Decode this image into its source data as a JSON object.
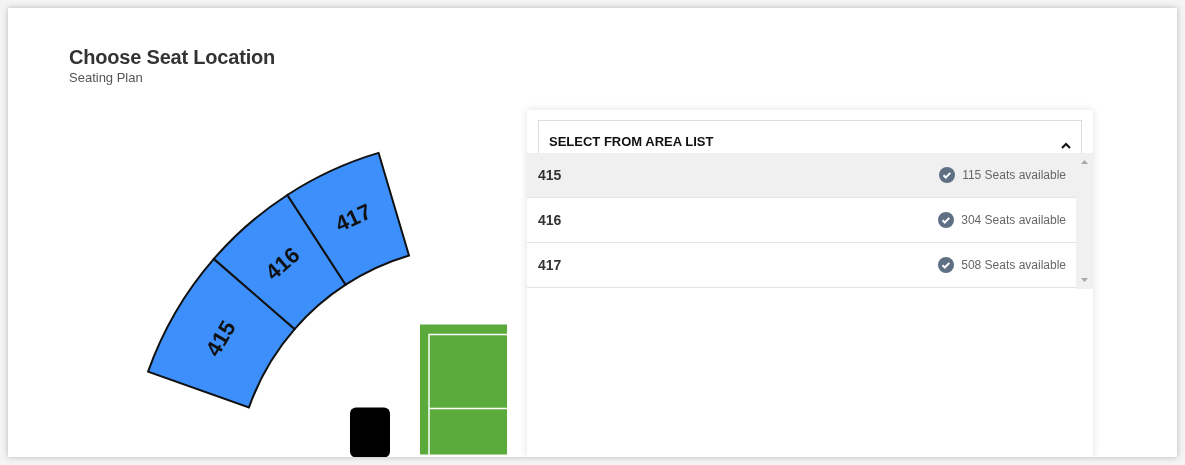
{
  "title": "Choose Seat Location",
  "subtitle": "Seating Plan",
  "seat_map": {
    "sections": [
      {
        "label": "415"
      },
      {
        "label": "416"
      },
      {
        "label": "417"
      }
    ]
  },
  "area_list": {
    "header": "SELECT FROM AREA LIST",
    "expanded": true,
    "items": [
      {
        "label": "415",
        "seats": "115 Seats available",
        "selected": true
      },
      {
        "label": "416",
        "seats": "304 Seats available",
        "selected": false
      },
      {
        "label": "417",
        "seats": "508 Seats available",
        "selected": false
      }
    ]
  }
}
